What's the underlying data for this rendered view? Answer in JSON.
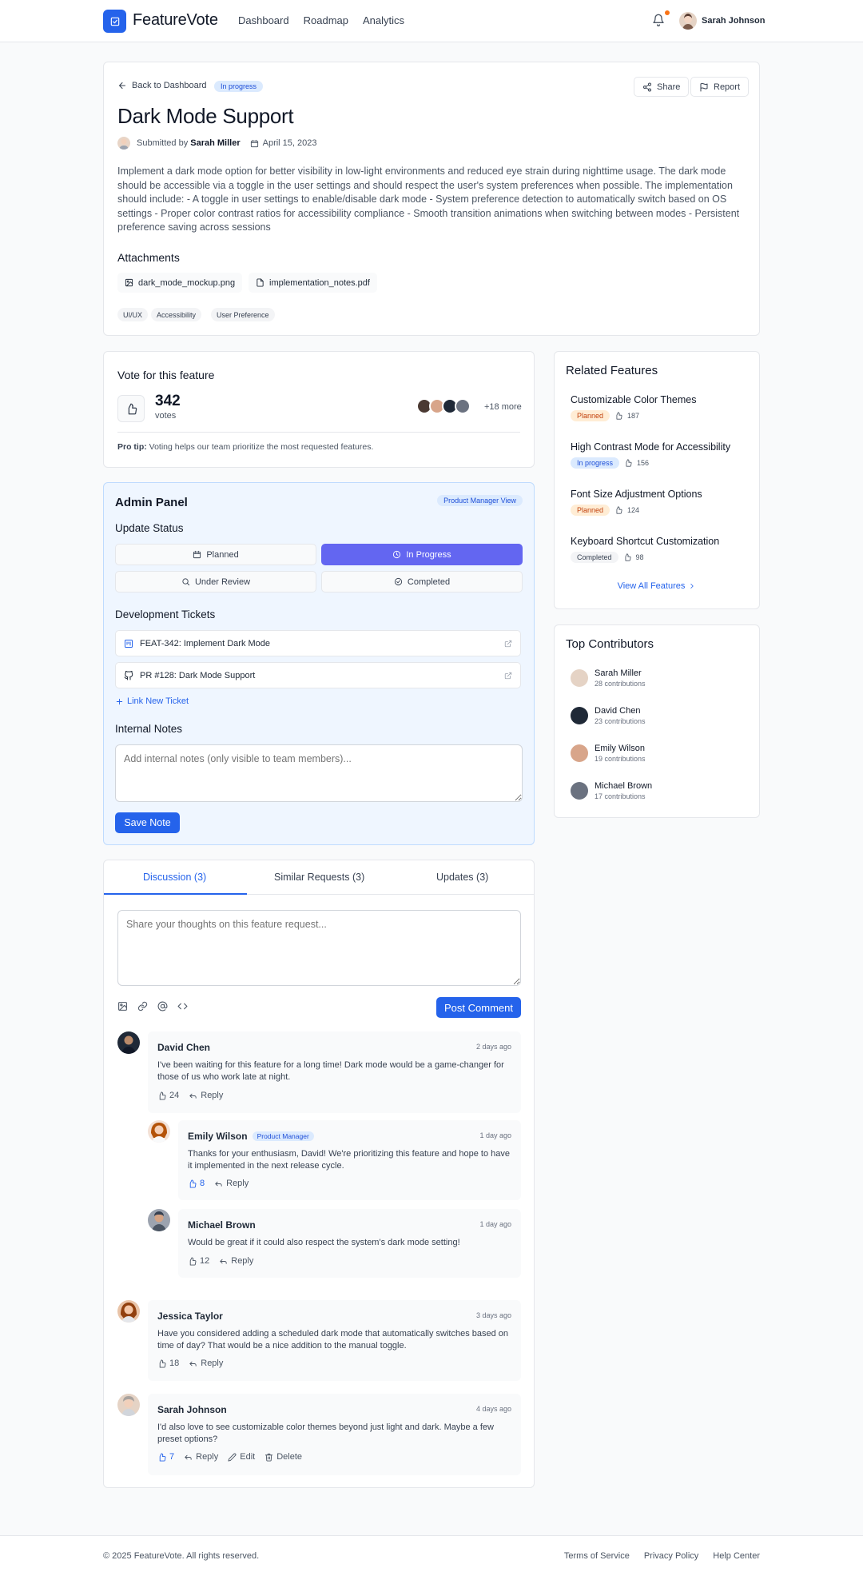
{
  "header": {
    "logo_text": "FeatureVote",
    "nav": [
      "Dashboard",
      "Roadmap",
      "Analytics"
    ],
    "user_name": "Sarah Johnson"
  },
  "feature": {
    "back_label": "Back to Dashboard",
    "status": "In progress",
    "share_label": "Share",
    "report_label": "Report",
    "title": "Dark Mode Support",
    "submitted_prefix": "Submitted by",
    "submitted_by": "Sarah Miller",
    "date": "April 15, 2023",
    "description": "Implement a dark mode option for better visibility in low-light environments and reduced eye strain during nighttime usage. The dark mode should be accessible via a toggle in the user settings and should respect the user's system preferences when possible. The implementation should include: - A toggle in user settings to enable/disable dark mode - System preference detection to automatically switch based on OS settings - Proper color contrast ratios for accessibility compliance - Smooth transition animations when switching between modes - Persistent preference saving across sessions",
    "attachments_title": "Attachments",
    "attachments": [
      "dark_mode_mockup.png",
      "implementation_notes.pdf"
    ],
    "tags": [
      "UI/UX",
      "Accessibility",
      "User Preference"
    ]
  },
  "vote": {
    "title": "Vote for this feature",
    "count": "342",
    "unit": "votes",
    "more": "+18 more",
    "tip_bold": "Pro tip:",
    "tip": " Voting helps our team prioritize the most requested features."
  },
  "admin": {
    "title": "Admin Panel",
    "badge": "Product Manager View",
    "status_title": "Update Status",
    "statuses": [
      "Planned",
      "In Progress",
      "Under Review",
      "Completed"
    ],
    "active_status": "In Progress",
    "tickets_title": "Development Tickets",
    "tickets": [
      "FEAT-342: Implement Dark Mode",
      "PR #128: Dark Mode Support"
    ],
    "link_ticket": "Link New Ticket",
    "notes_title": "Internal Notes",
    "notes_placeholder": "Add internal notes (only visible to team members)...",
    "save_label": "Save Note"
  },
  "discussion": {
    "tabs": [
      "Discussion (3)",
      "Similar Requests (3)",
      "Updates (3)"
    ],
    "placeholder": "Share your thoughts on this feature request...",
    "post_label": "Post Comment",
    "reply_label": "Reply",
    "edit_label": "Edit",
    "delete_label": "Delete",
    "comments": [
      {
        "name": "David Chen",
        "time": "2 days ago",
        "text": "I've been waiting for this feature for a long time! Dark mode would be a game-changer for those of us who work late at night.",
        "likes": "24"
      },
      {
        "name": "Emily Wilson",
        "role": "Product Manager",
        "time": "1 day ago",
        "text": "Thanks for your enthusiasm, David! We're prioritizing this feature and hope to have it implemented in the next release cycle.",
        "likes": "8"
      },
      {
        "name": "Michael Brown",
        "time": "1 day ago",
        "text": "Would be great if it could also respect the system's dark mode setting!",
        "likes": "12"
      },
      {
        "name": "Jessica Taylor",
        "time": "3 days ago",
        "text": "Have you considered adding a scheduled dark mode that automatically switches based on time of day? That would be a nice addition to the manual toggle.",
        "likes": "18"
      },
      {
        "name": "Sarah Johnson",
        "time": "4 days ago",
        "text": "I'd also love to see customizable color themes beyond just light and dark. Maybe a few preset options?",
        "likes": "7"
      }
    ]
  },
  "related": {
    "title": "Related Features",
    "items": [
      {
        "title": "Customizable Color Themes",
        "status": "Planned",
        "votes": "187"
      },
      {
        "title": "High Contrast Mode for Accessibility",
        "status": "In progress",
        "votes": "156"
      },
      {
        "title": "Font Size Adjustment Options",
        "status": "Planned",
        "votes": "124"
      },
      {
        "title": "Keyboard Shortcut Customization",
        "status": "Completed",
        "votes": "98"
      }
    ],
    "view_all": "View All Features"
  },
  "contributors": {
    "title": "Top Contributors",
    "items": [
      {
        "name": "Sarah Miller",
        "count": "28 contributions"
      },
      {
        "name": "David Chen",
        "count": "23 contributions"
      },
      {
        "name": "Emily Wilson",
        "count": "19 contributions"
      },
      {
        "name": "Michael Brown",
        "count": "17 contributions"
      }
    ]
  },
  "footer": {
    "copyright": "© 2025 FeatureVote. All rights reserved.",
    "links": [
      "Terms of Service",
      "Privacy Policy",
      "Help Center"
    ]
  },
  "colors": {
    "brand": "#2563eb",
    "active_status": "#6366f1",
    "admin_bg": "#eff6ff"
  }
}
